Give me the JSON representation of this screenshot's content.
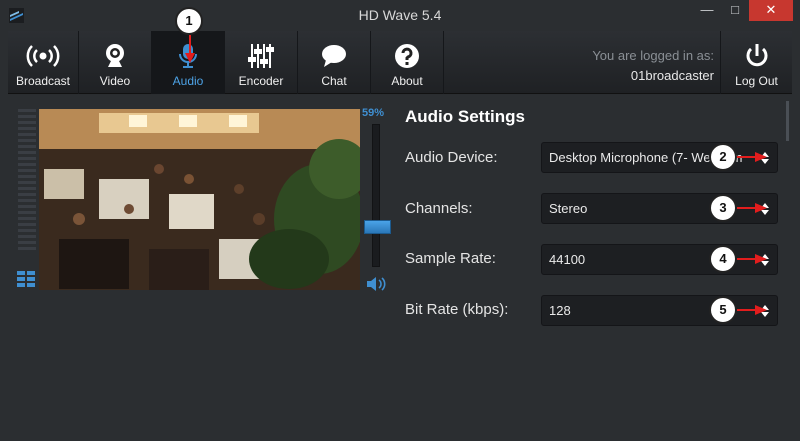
{
  "window": {
    "title": "HD Wave 5.4",
    "minimize_glyph": "—",
    "maximize_glyph": "□",
    "close_glyph": "✕"
  },
  "toolbar": {
    "items": [
      {
        "label": "Broadcast",
        "icon": "broadcast-icon"
      },
      {
        "label": "Video",
        "icon": "webcam-icon"
      },
      {
        "label": "Audio",
        "icon": "microphone-icon",
        "active": true
      },
      {
        "label": "Encoder",
        "icon": "sliders-icon"
      },
      {
        "label": "Chat",
        "icon": "chat-bubble-icon"
      },
      {
        "label": "About",
        "icon": "question-icon"
      }
    ],
    "login_text": "You are logged in as:",
    "username": "01broadcaster",
    "logout_label": "Log Out",
    "active_color": "#4da3e6"
  },
  "volume": {
    "percent_label": "59%",
    "level": 0.59
  },
  "settings": {
    "title": "Audio Settings",
    "rows": [
      {
        "label": "Audio Device:",
        "value": "Desktop Microphone (7- Webcam"
      },
      {
        "label": "Channels:",
        "value": "Stereo"
      },
      {
        "label": "Sample Rate:",
        "value": "44100"
      },
      {
        "label": "Bit Rate (kbps):",
        "value": "128"
      }
    ]
  },
  "callouts": [
    "1",
    "2",
    "3",
    "4",
    "5"
  ]
}
